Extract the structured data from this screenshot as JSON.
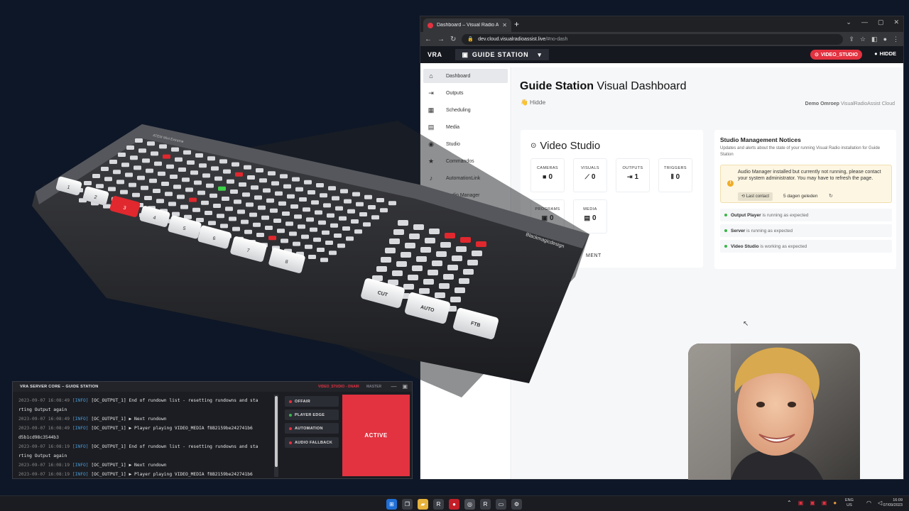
{
  "browser": {
    "tab_title": "Dashboard – Visual Radio Assist",
    "url_main": "dev.cloud.visualradioassist.live",
    "url_rest": "/#no-dash"
  },
  "app": {
    "brand": "VRA",
    "station": "GUIDE STATION",
    "studio_pill": "VIDEO_STUDIO",
    "user": "HIDDE",
    "accent": "#e33240"
  },
  "sidebar": {
    "items": [
      {
        "label": "Dashboard",
        "icon": "home-icon"
      },
      {
        "label": "Outputs",
        "icon": "output-icon"
      },
      {
        "label": "Scheduling",
        "icon": "calendar-icon"
      },
      {
        "label": "Media",
        "icon": "media-icon"
      },
      {
        "label": "Studio",
        "icon": "studio-icon"
      },
      {
        "label": "Commandos",
        "icon": "star-icon"
      },
      {
        "label": "AutomationLink",
        "icon": "music-icon"
      },
      {
        "label": "Audio Manager",
        "icon": "audio-icon"
      }
    ]
  },
  "dashboard": {
    "title_bold": "Guide Station",
    "title_rest": "Visual Dashboard",
    "greeting": "Hidde",
    "org_bold": "Demo Omroep",
    "org_rest": "VisualRadioAssist Cloud"
  },
  "studio_card": {
    "title": "Video Studio",
    "stats": [
      {
        "label": "CAMERAS",
        "value": "0"
      },
      {
        "label": "VISUALS",
        "value": "0"
      },
      {
        "label": "OUTPUTS",
        "value": "1"
      },
      {
        "label": "TRIGGERS",
        "value": "0"
      },
      {
        "label": "PROGRAMS",
        "value": "0"
      },
      {
        "label": "MEDIA",
        "value": "0"
      }
    ],
    "footer_text": "MENT"
  },
  "notices": {
    "title": "Studio Management Notices",
    "desc": "Updates and alerts about the state of your running Visual Radio installation for Guide Station",
    "warning": "Audio Manager installed but currently not running, please contact your system administrator. You may have to refresh the page.",
    "last_contact_label": "Last contact",
    "last_contact_value": "5 dagen geleden",
    "status": [
      {
        "name": "Output Player",
        "text": "is running as expected"
      },
      {
        "name": "Server",
        "text": "is running as expected"
      },
      {
        "name": "Video Studio",
        "text": "is working as expected"
      }
    ]
  },
  "server_core": {
    "title": "VRA SERVER CORE – GUIDE STATION",
    "onair": "VIDEO_STUDIO - ONAIR",
    "master": "MASTER",
    "log": [
      {
        "ts": "2023-09-07 16:08:49",
        "lv": "[INFO]",
        "msg": "[OC_OUTPUT_1] End of rundown list - resetting rundowns and sta"
      },
      {
        "ts": "",
        "lv": "",
        "msg": "rting Output again"
      },
      {
        "ts": "2023-09-07 16:08:49",
        "lv": "[INFO]",
        "msg": "[OC_OUTPUT_1] ▶ Next rundown"
      },
      {
        "ts": "2023-09-07 16:08:49",
        "lv": "[INFO]",
        "msg": "[OC_OUTPUT_1] ▶ Player playing VIDEO_MEDIA f8B2159be242741b6"
      },
      {
        "ts": "",
        "lv": "",
        "msg": "d5b1cd98c3544b3"
      },
      {
        "ts": "2023-09-07 16:08:19",
        "lv": "[INFO]",
        "msg": "[OC_OUTPUT_1] End of rundown list - resetting rundowns and sta"
      },
      {
        "ts": "",
        "lv": "",
        "msg": "rting Output again"
      },
      {
        "ts": "2023-09-07 16:08:19",
        "lv": "[INFO]",
        "msg": "[OC_OUTPUT_1] ▶ Next rundown"
      },
      {
        "ts": "2023-09-07 16:08:19",
        "lv": "[INFO]",
        "msg": "[OC_OUTPUT_1] ▶ Player playing VIDEO_MEDIA f8B2159be242741b6"
      }
    ],
    "modes": [
      {
        "label": "OFFAIR",
        "color": "#e33240"
      },
      {
        "label": "PLAYER EDGE",
        "color": "#39b54a"
      },
      {
        "label": "AUTOMATION",
        "color": "#e33240"
      },
      {
        "label": "AUDIO FALLBACK",
        "color": "#e33240"
      }
    ],
    "active_label": "ACTIVE"
  },
  "atem": {
    "brand": "Blackmagicdesign",
    "model": "ATEM Mini Extreme",
    "buttons": [
      "CUT",
      "AUTO",
      "FTB"
    ],
    "numbers": [
      "1",
      "2",
      "3",
      "4",
      "5",
      "6",
      "7",
      "8"
    ]
  },
  "taskbar": {
    "lang_top": "ENG",
    "lang_bottom": "US",
    "time": "16:09",
    "date": "07/09/2023"
  }
}
